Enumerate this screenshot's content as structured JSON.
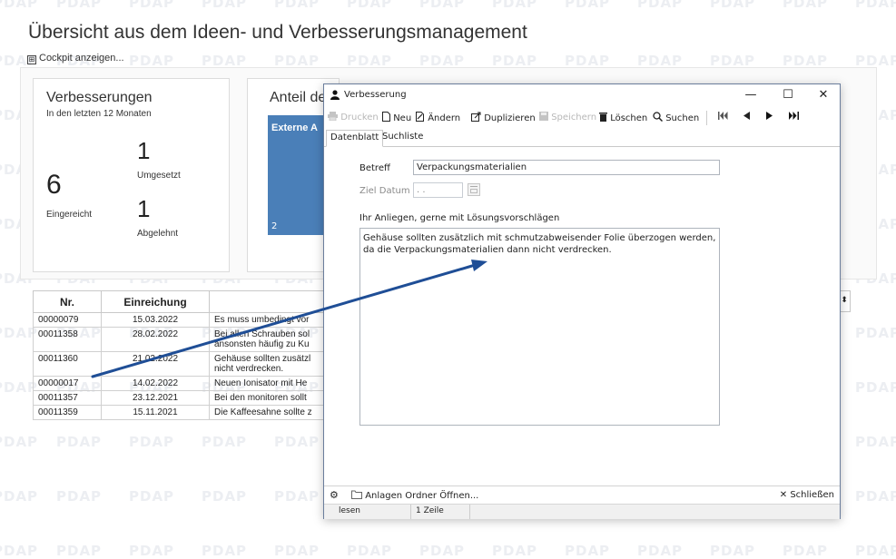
{
  "watermark_text": "PDAP",
  "page": {
    "title": "Übersicht aus dem Ideen- und Verbesserungsmanagement",
    "cockpit_toggle_symbol": "⊞",
    "cockpit_label": "Cockpit anzeigen..."
  },
  "card": {
    "title": "Verbesserungen",
    "subtitle": "In den letzten 12 Monaten",
    "submitted_count": "6",
    "submitted_label": "Eingereicht",
    "implemented_count": "1",
    "implemented_label": "Umgesetzt",
    "rejected_count": "1",
    "rejected_label": "Abgelehnt"
  },
  "share_panel": {
    "title": "Anteil de",
    "bar_label": "Externe A",
    "bar_value": "2",
    "bar_color": "#4a7fb8"
  },
  "table": {
    "headers": [
      "Nr.",
      "Einreichung",
      ""
    ],
    "rows": [
      {
        "nr": "00000079",
        "date": "15.03.2022",
        "text": "Es muss umbedingt vor"
      },
      {
        "nr": "00011358",
        "date": "28.02.2022",
        "text": "Bei allen Schrauben sol",
        "text2": "ansonsten häufig zu Ku"
      },
      {
        "nr": "00011360",
        "date": "21.02.2022",
        "text": "Gehäuse sollten zusätzl",
        "text2": "nicht verdrecken."
      },
      {
        "nr": "00000017",
        "date": "14.02.2022",
        "text": "Neuen Ionisator mit He"
      },
      {
        "nr": "00011357",
        "date": "23.12.2021",
        "text": "Bei den monitoren sollt"
      },
      {
        "nr": "00011359",
        "date": "15.11.2021",
        "text": "Die Kaffeesahne sollte z"
      }
    ],
    "sort_icon": "⬍"
  },
  "dialog": {
    "title": "Verbesserung",
    "window_buttons": {
      "minimize": "—",
      "maximize": "☐",
      "close": "✕"
    },
    "toolbar": {
      "print": "Drucken",
      "new": "Neu",
      "edit": "Ändern",
      "duplicate": "Duplizieren",
      "save": "Speichern",
      "delete": "Löschen",
      "search": "Suchen"
    },
    "tabs": [
      "Datenblatt",
      "Suchliste"
    ],
    "fields": {
      "subject_label": "Betreff",
      "subject_value": "Verpackungsmaterialien",
      "target_date_label": "Ziel Datum",
      "target_date_value": ". .",
      "concern_label": "Ihr Anliegen, gerne mit Lösungsvorschlägen",
      "concern_value": "Gehäuse sollten zusätzlich mit schmutzabweisender Folie überzogen werden, da die Verpackungsmaterialien dann nicht verdrecken."
    },
    "bottom": {
      "open_attachments": "Anlagen Ordner Öffnen...",
      "close": "Schließen"
    },
    "status": {
      "mode": "lesen",
      "rows": "1 Zeile"
    }
  },
  "colors": {
    "arrow": "#1f4e96",
    "accent_blue": "#4a7fb8",
    "watermark": "#eceef2"
  }
}
